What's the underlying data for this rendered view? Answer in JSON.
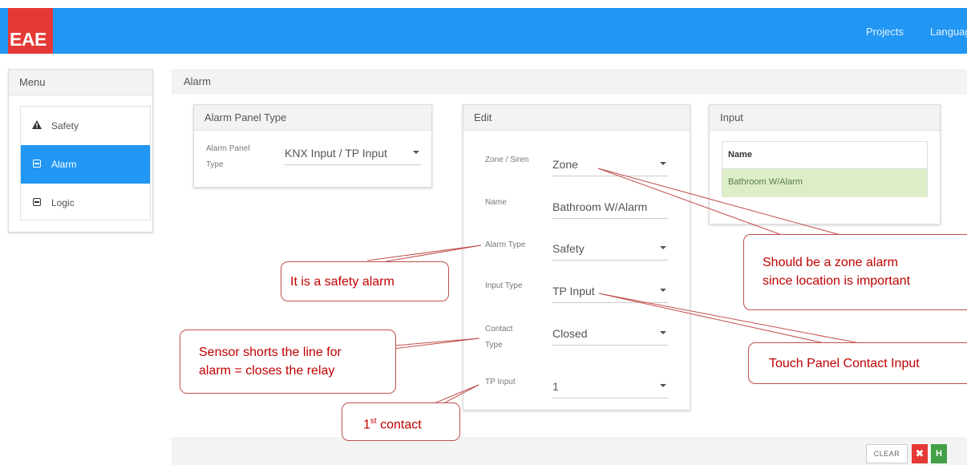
{
  "app": {
    "logo": "EAE",
    "nav": {
      "projects": "Projects",
      "language": "Language"
    }
  },
  "menu": {
    "title": "Menu",
    "items": [
      {
        "label": "Safety",
        "icon": "warning-icon"
      },
      {
        "label": "Alarm",
        "icon": "alarm-panel-icon",
        "active": true
      },
      {
        "label": "Logic",
        "icon": "logic-icon"
      }
    ]
  },
  "main": {
    "title": "Alarm"
  },
  "alarm_panel_type": {
    "title": "Alarm Panel Type",
    "label_line1": "Alarm Panel",
    "label_line2": "Type",
    "value": "KNX Input / TP Input"
  },
  "edit": {
    "title": "Edit",
    "zone_siren": {
      "label": "Zone / Siren",
      "value": "Zone"
    },
    "name": {
      "label": "Name",
      "value": "Bathroom W/Alarm"
    },
    "alarm_type": {
      "label": "Alarm Type",
      "value": "Safety"
    },
    "input_type": {
      "label": "Input Type",
      "value": "TP Input"
    },
    "contact_type": {
      "label_line1": "Contact",
      "label_line2": "Type",
      "value": "Closed"
    },
    "tp_input": {
      "label": "TP Input",
      "value": "1"
    }
  },
  "input_card": {
    "title": "Input",
    "column": "Name",
    "rows": [
      "Bathroom W/Alarm"
    ]
  },
  "footer": {
    "clear_label": "CLEAR",
    "cancel_glyph": "✖",
    "save_glyph": "H"
  },
  "annotations": {
    "safety": "It is a safety alarm",
    "sensor_line1": "Sensor shorts the line for",
    "sensor_line2": "alarm = closes the relay",
    "contact_ordinal": "1",
    "contact_sup": "st",
    "contact_rest": " contact",
    "zone_line1": "Should be a zone alarm",
    "zone_line2": "since location is important",
    "touch": "Touch Panel Contact Input"
  },
  "colors": {
    "topbar": "#2196f3",
    "logo": "#e53935",
    "callout": "#c00000",
    "selected_row": "#dcedc8"
  }
}
